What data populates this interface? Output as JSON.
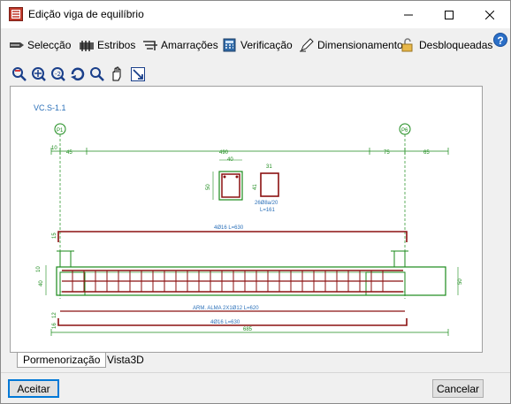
{
  "window": {
    "title": "Edição viga de equilíbrio"
  },
  "menu": [
    {
      "label": "Selecção",
      "icon": "selection-icon"
    },
    {
      "label": "Estribos",
      "icon": "stirrups-icon"
    },
    {
      "label": "Amarrações",
      "icon": "anchorage-icon"
    },
    {
      "label": "Verificação",
      "icon": "calculator-icon"
    },
    {
      "label": "Dimensionamento",
      "icon": "pencil-icon"
    },
    {
      "label": "Desbloqueadas",
      "icon": "unlock-icon"
    }
  ],
  "help": "?",
  "drawing": {
    "beam_ref": "VC.S-1.1",
    "column_left": "P1",
    "column_right": "P6",
    "dims_top": [
      "10",
      "45",
      "490",
      "75",
      "65"
    ],
    "section_width": "40",
    "section_height": "50",
    "stirrup_top": "31",
    "stirrup_side": "41",
    "stirrup_spec": "26Ø8a/20",
    "stirrup_length": "L=161",
    "top_bar": "4Ø16  L=630",
    "top_anchor": "15",
    "left_dims": [
      "10",
      "40"
    ],
    "right_dim": "50",
    "web_bars": "ARM. ALMA 2X1Ø12  L=620",
    "bottom_bar": "4Ø16  L=630",
    "bottom_left_dims": [
      "12",
      "16"
    ],
    "total_length": "685"
  },
  "tabs": [
    "Pormenorização",
    "Vista3D"
  ],
  "buttons": {
    "accept": "Aceitar",
    "cancel": "Cancelar"
  }
}
